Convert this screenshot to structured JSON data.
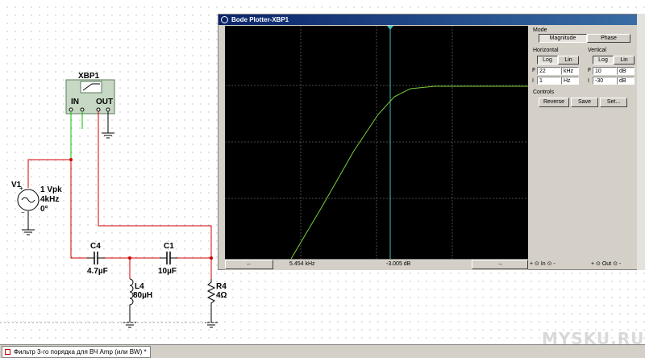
{
  "schematic": {
    "bode_instrument_name": "XBP1",
    "bode_in_label": "IN",
    "bode_out_label": "OUT",
    "source": {
      "name": "V1",
      "amplitude": "1 Vpk",
      "frequency": "4kHz",
      "phase": "0°"
    },
    "c4": {
      "name": "C4",
      "value": "4.7µF"
    },
    "c1": {
      "name": "C1",
      "value": "10µF"
    },
    "l4": {
      "name": "L4",
      "value": "80µH"
    },
    "r4": {
      "name": "R4",
      "value": "4Ω"
    }
  },
  "bode_window": {
    "title": "Bode Plotter-XBP1",
    "mode_label": "Mode",
    "magnitude_button": "Magnitude",
    "phase_button": "Phase",
    "horizontal_label": "Horizontal",
    "vertical_label": "Vertical",
    "h_log": "Log",
    "h_lin": "Lin",
    "v_log": "Log",
    "v_lin": "Lin",
    "h_final_label": "F",
    "h_final_value": "22",
    "h_final_unit": "kHz",
    "h_initial_label": "I",
    "h_initial_value": "1",
    "h_initial_unit": "Hz",
    "v_final_label": "F",
    "v_final_value": "10",
    "v_final_unit": "dB",
    "v_initial_label": "I",
    "v_initial_value": "-30",
    "v_initial_unit": "dB",
    "controls_label": "Controls",
    "reverse_button": "Reverse",
    "save_button": "Save",
    "set_button": "Set...",
    "left_arrow": "←",
    "right_arrow": "→",
    "readout_frequency": "5.454 kHz",
    "readout_gain": "-3.005 dB",
    "in_terminal_label": "+ ⊙  In  ⊙ -",
    "out_terminal_label": "+ ⊙  Out  ⊙ -"
  },
  "status_bar": {
    "tab_label": "Фильтр 3-го порядка для ВЧ Amp (или BW) *"
  },
  "watermark": "MYSKU.RU",
  "colors": {
    "wire_red": "#d40000",
    "wire_green": "#00c000",
    "trace_green": "#7ccf3a",
    "cursor_cyan": "#40c0c0",
    "title_blue": "#0a246a"
  }
}
